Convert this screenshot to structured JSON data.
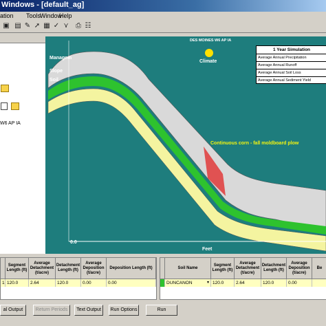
{
  "window": {
    "title": "Windows - [default_ag]"
  },
  "menu": {
    "items": [
      "Tools",
      "Window",
      "Help"
    ],
    "partial_first": "ation"
  },
  "left_panel": {
    "location_label": "W6 AP IA"
  },
  "plot": {
    "station": "DES MOINES W6 AP IA",
    "climate_label": "Climate",
    "management_label": "Managem",
    "slope_label": "Slope",
    "soil_label": "Soil",
    "crop_label": "Continuous corn - fall moldboard plow",
    "x_tick": "0.0",
    "x_axis_label": "Feet"
  },
  "simulation": {
    "title": "1 Year Simulation",
    "rows": [
      "Average Annual Precipitation",
      "Average Annual Runoff",
      "Average Annual Soil Loss",
      "Average Annual Sediment Yield"
    ]
  },
  "left_grid": {
    "headers": [
      "",
      "Segment Length (ft)",
      "Average Detachment (t/acre)",
      "Detachment Length (ft)",
      "Average Deposition (t/acre)",
      "Deposition Length (ft)"
    ],
    "row": [
      "1",
      "120.0",
      "2.64",
      "120.0",
      "0.00",
      "0.00"
    ]
  },
  "right_grid": {
    "headers": [
      "",
      "Soil Name",
      "Segment Length (ft)",
      "Average Detachment (t/acre)",
      "Detachment Length (ft)",
      "Average Deposition (t/acre)",
      "Be"
    ],
    "row": [
      "",
      "DUNCANON",
      "120.0",
      "2.64",
      "120.0",
      "0.00",
      ""
    ]
  },
  "buttons": {
    "annual_output": "al Output",
    "return_periods": "Return Periods",
    "text_output": "Text Output",
    "run_options": "Run Options",
    "run": "Run"
  },
  "colors": {
    "plot_bg": "#1e7d7d",
    "management": "#d9d9d9",
    "slope": "#33cc33",
    "soil": "#f4f4a0",
    "loss": "#e03a3a"
  }
}
